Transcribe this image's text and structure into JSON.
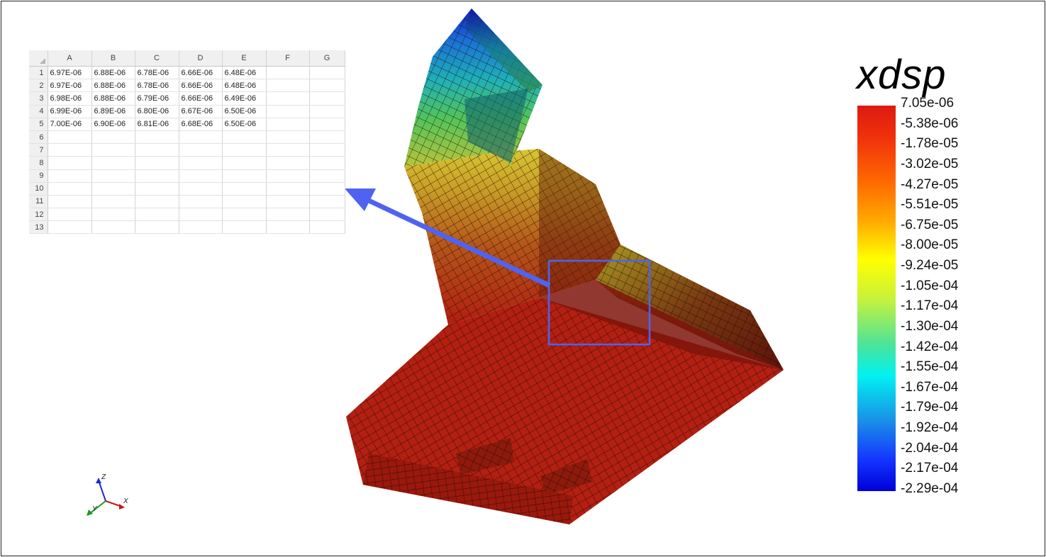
{
  "spreadsheet": {
    "columns": [
      "A",
      "B",
      "C",
      "D",
      "E",
      "F",
      "G"
    ],
    "rows": [
      {
        "num": "1",
        "cells": [
          "6.97E-06",
          "6.88E-06",
          "6.78E-06",
          "6.66E-06",
          "6.48E-06",
          "",
          ""
        ]
      },
      {
        "num": "2",
        "cells": [
          "6.97E-06",
          "6.88E-06",
          "6.78E-06",
          "6.66E-06",
          "6.48E-06",
          "",
          ""
        ]
      },
      {
        "num": "3",
        "cells": [
          "6.98E-06",
          "6.88E-06",
          "6.79E-06",
          "6.66E-06",
          "6.49E-06",
          "",
          ""
        ]
      },
      {
        "num": "4",
        "cells": [
          "6.99E-06",
          "6.89E-06",
          "6.80E-06",
          "6.67E-06",
          "6.50E-06",
          "",
          ""
        ]
      },
      {
        "num": "5",
        "cells": [
          "7.00E-06",
          "6.90E-06",
          "6.81E-06",
          "6.68E-06",
          "6.50E-06",
          "",
          ""
        ]
      },
      {
        "num": "6",
        "cells": [
          "",
          "",
          "",
          "",
          "",
          "",
          ""
        ]
      },
      {
        "num": "7",
        "cells": [
          "",
          "",
          "",
          "",
          "",
          "",
          ""
        ]
      },
      {
        "num": "8",
        "cells": [
          "",
          "",
          "",
          "",
          "",
          "",
          ""
        ]
      },
      {
        "num": "9",
        "cells": [
          "",
          "",
          "",
          "",
          "",
          "",
          ""
        ]
      },
      {
        "num": "10",
        "cells": [
          "",
          "",
          "",
          "",
          "",
          "",
          ""
        ]
      },
      {
        "num": "11",
        "cells": [
          "",
          "",
          "",
          "",
          "",
          "",
          ""
        ]
      },
      {
        "num": "12",
        "cells": [
          "",
          "",
          "",
          "",
          "",
          "",
          ""
        ]
      },
      {
        "num": "13",
        "cells": [
          "",
          "",
          "",
          "",
          "",
          "",
          ""
        ]
      }
    ]
  },
  "legend": {
    "title": "xdsp",
    "ticks": [
      "7.05e-06",
      "-5.38e-06",
      "-1.78e-05",
      "-3.02e-05",
      "-4.27e-05",
      "-5.51e-05",
      "-6.75e-05",
      "-8.00e-05",
      "-9.24e-05",
      "-1.05e-04",
      "-1.17e-04",
      "-1.30e-04",
      "-1.42e-04",
      "-1.55e-04",
      "-1.67e-04",
      "-1.79e-04",
      "-1.92e-04",
      "-2.04e-04",
      "-2.17e-04",
      "-2.29e-04"
    ]
  },
  "axes_widget": {
    "x": "X",
    "y": "Y",
    "z": "Z"
  },
  "colors": {
    "arrow": "#4f63f0",
    "highlight_box": "#4f63f0",
    "mesh_red": "#b41d10",
    "mesh_dark": "#6a140c"
  }
}
